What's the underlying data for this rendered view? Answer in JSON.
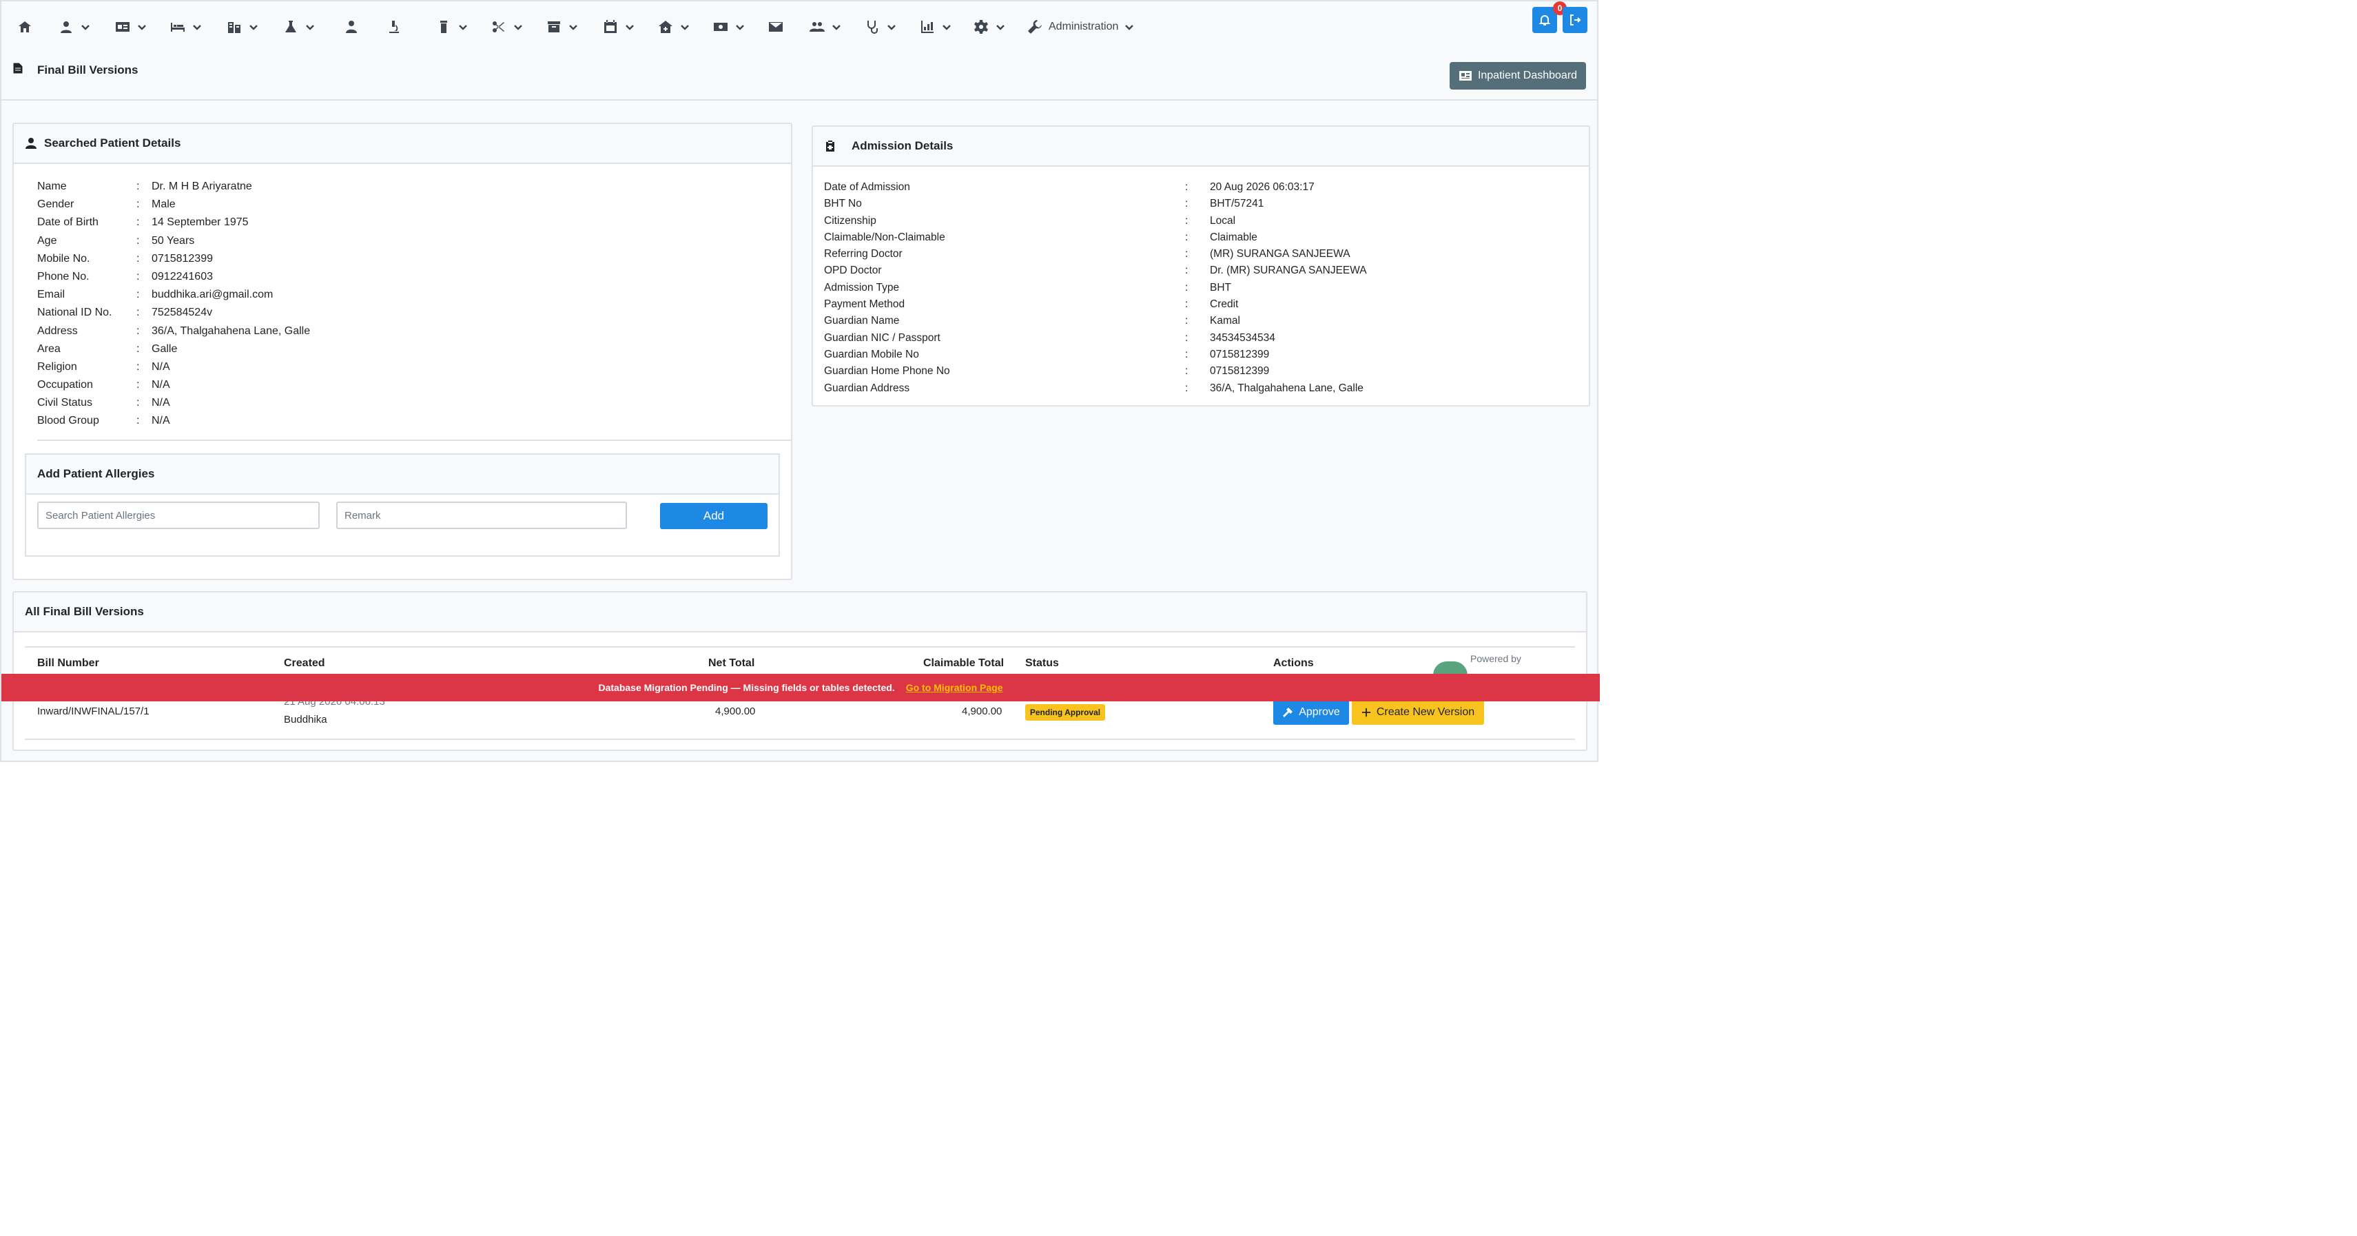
{
  "nav": {
    "administration_label": "Administration",
    "notification_count": "0"
  },
  "page": {
    "title": "Final Bill Versions",
    "dashboard_button": "Inpatient Dashboard"
  },
  "patient": {
    "title": "Searched Patient Details",
    "fields": [
      {
        "label": "Name",
        "value": "Dr. M H B Ariyaratne"
      },
      {
        "label": "Gender",
        "value": "Male"
      },
      {
        "label": "Date of Birth",
        "value": "14 September 1975"
      },
      {
        "label": "Age",
        "value": "50 Years"
      },
      {
        "label": "Mobile No.",
        "value": "0715812399"
      },
      {
        "label": "Phone No.",
        "value": "0912241603"
      },
      {
        "label": "Email",
        "value": "buddhika.ari@gmail.com"
      },
      {
        "label": "National ID No.",
        "value": "752584524v"
      },
      {
        "label": "Address",
        "value": "36/A, Thalgahahena Lane, Galle"
      },
      {
        "label": "Area",
        "value": "Galle"
      },
      {
        "label": "Religion",
        "value": "N/A"
      },
      {
        "label": "Occupation",
        "value": "N/A"
      },
      {
        "label": "Civil Status",
        "value": "N/A"
      },
      {
        "label": "Blood Group",
        "value": "N/A"
      }
    ]
  },
  "allergies": {
    "title": "Add Patient Allergies",
    "search_placeholder": "Search Patient Allergies",
    "remark_placeholder": "Remark",
    "add_label": "Add"
  },
  "admission": {
    "title": "Admission Details",
    "fields": [
      {
        "label": "Date of Admission",
        "value": "20 Aug 2026 06:03:17"
      },
      {
        "label": "BHT No",
        "value": "BHT/57241"
      },
      {
        "label": "Citizenship",
        "value": "Local"
      },
      {
        "label": "Claimable/Non-Claimable",
        "value": "Claimable"
      },
      {
        "label": "Referring Doctor",
        "value": "(MR) SURANGA SANJEEWA"
      },
      {
        "label": "OPD Doctor",
        "value": "Dr. (MR) SURANGA SANJEEWA"
      },
      {
        "label": "Admission Type",
        "value": "BHT"
      },
      {
        "label": "Payment Method",
        "value": "Credit"
      },
      {
        "label": "Guardian Name",
        "value": "Kamal"
      },
      {
        "label": "Guardian NIC / Passport",
        "value": "34534534534"
      },
      {
        "label": "Guardian Mobile No",
        "value": "0715812399"
      },
      {
        "label": "Guardian Home Phone No",
        "value": "0715812399"
      },
      {
        "label": "Guardian Address",
        "value": "36/A, Thalgahahena Lane, Galle"
      }
    ]
  },
  "bills": {
    "title": "All Final Bill Versions",
    "headers": {
      "bill_number": "Bill Number",
      "created": "Created",
      "net_total": "Net Total",
      "claimable_total": "Claimable Total",
      "status": "Status",
      "actions": "Actions"
    },
    "rows": [
      {
        "bill_number": "Inward/INWFINAL/157/1",
        "created_date": "21 Aug 2026 04:06:13",
        "created_by": "Buddhika",
        "net_total": "4,900.00",
        "claimable_total": "4,900.00",
        "status": "Pending Approval",
        "approve_label": "Approve",
        "new_version_label": "Create New Version"
      }
    ]
  },
  "banner": {
    "message": "Database Migration Pending — Missing fields or tables detected.",
    "link": "Go to Migration Page"
  },
  "footer": {
    "powered_by": "Powered by"
  },
  "colors": {
    "primary": "#1e88e5",
    "warning": "#f9c31f",
    "danger": "#dc3545",
    "secondary": "#546e7a"
  }
}
